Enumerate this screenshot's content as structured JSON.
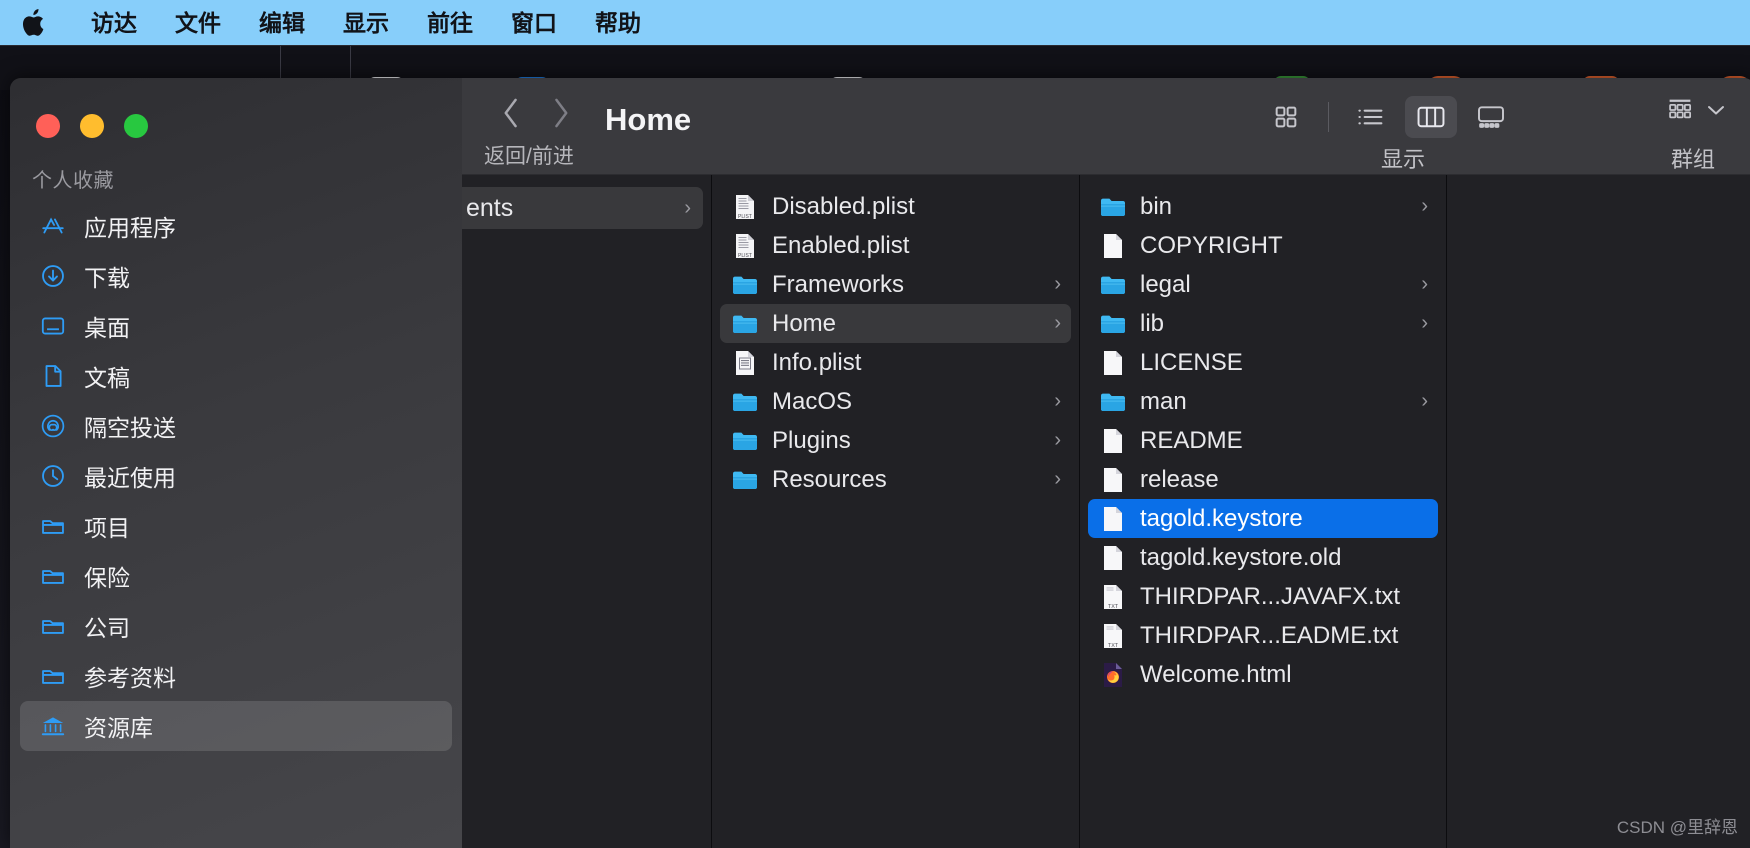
{
  "menubar": {
    "apple_icon": "apple-logo-icon",
    "background": "#87cefa",
    "items": [
      {
        "label": "访达"
      },
      {
        "label": "文件"
      },
      {
        "label": "编辑"
      },
      {
        "label": "显示"
      },
      {
        "label": "前往"
      },
      {
        "label": "窗口"
      },
      {
        "label": "帮助"
      }
    ]
  },
  "window": {
    "title": "Home",
    "traffic_lights": {
      "close": "#ff6058",
      "minimize": "#ffbd2e",
      "zoom": "#28c840"
    }
  },
  "toolbar": {
    "back_icon": "chevron-left-icon",
    "forward_icon": "chevron-right-icon",
    "nav_label": "返回/前进",
    "view_label": "显示",
    "group_label": "群组",
    "group_chevron_icon": "chevron-down-icon",
    "view_modes": [
      {
        "name": "icon-view",
        "icon": "grid-icon",
        "selected": false
      },
      {
        "name": "list-view",
        "icon": "list-icon",
        "selected": false
      },
      {
        "name": "column-view",
        "icon": "columns-icon",
        "selected": true
      },
      {
        "name": "gallery-view",
        "icon": "gallery-icon",
        "selected": false
      }
    ]
  },
  "sidebar": {
    "section_title": "个人收藏",
    "items": [
      {
        "label": "应用程序",
        "icon": "applications-icon",
        "selected": false
      },
      {
        "label": "下载",
        "icon": "downloads-icon",
        "selected": false
      },
      {
        "label": "桌面",
        "icon": "desktop-icon",
        "selected": false
      },
      {
        "label": "文稿",
        "icon": "documents-icon",
        "selected": false
      },
      {
        "label": "隔空投送",
        "icon": "airdrop-icon",
        "selected": false
      },
      {
        "label": "最近使用",
        "icon": "recents-clock-icon",
        "selected": false
      },
      {
        "label": "项目",
        "icon": "folder-icon",
        "selected": false
      },
      {
        "label": "保险",
        "icon": "folder-icon",
        "selected": false
      },
      {
        "label": "公司",
        "icon": "folder-icon",
        "selected": false
      },
      {
        "label": "参考资料",
        "icon": "folder-icon",
        "selected": false
      },
      {
        "label": "资源库",
        "icon": "library-bank-icon",
        "selected": true
      }
    ]
  },
  "columns": {
    "partial_column": {
      "items": [
        {
          "name": "ents",
          "icon": "folder-icon",
          "has_chevron": true,
          "highlighted": true
        }
      ]
    },
    "middle_column": {
      "items": [
        {
          "name": "Disabled.plist",
          "icon": "plist-file-icon",
          "has_chevron": false,
          "selected": false
        },
        {
          "name": "Enabled.plist",
          "icon": "plist-file-icon",
          "has_chevron": false,
          "selected": false
        },
        {
          "name": "Frameworks",
          "icon": "folder-icon",
          "has_chevron": true,
          "selected": false
        },
        {
          "name": "Home",
          "icon": "folder-icon",
          "has_chevron": true,
          "selected": true
        },
        {
          "name": "Info.plist",
          "icon": "plist-doc-icon",
          "has_chevron": false,
          "selected": false
        },
        {
          "name": "MacOS",
          "icon": "folder-icon",
          "has_chevron": true,
          "selected": false
        },
        {
          "name": "Plugins",
          "icon": "folder-icon",
          "has_chevron": true,
          "selected": false
        },
        {
          "name": "Resources",
          "icon": "folder-icon",
          "has_chevron": true,
          "selected": false
        }
      ]
    },
    "right_column": {
      "items": [
        {
          "name": "bin",
          "icon": "folder-icon",
          "has_chevron": true,
          "selected": false
        },
        {
          "name": "COPYRIGHT",
          "icon": "blank-file-icon",
          "has_chevron": false,
          "selected": false
        },
        {
          "name": "legal",
          "icon": "folder-icon",
          "has_chevron": true,
          "selected": false
        },
        {
          "name": "lib",
          "icon": "folder-icon",
          "has_chevron": true,
          "selected": false
        },
        {
          "name": "LICENSE",
          "icon": "blank-file-icon",
          "has_chevron": false,
          "selected": false
        },
        {
          "name": "man",
          "icon": "folder-icon",
          "has_chevron": true,
          "selected": false
        },
        {
          "name": "README",
          "icon": "blank-file-icon",
          "has_chevron": false,
          "selected": false
        },
        {
          "name": "release",
          "icon": "blank-file-icon",
          "has_chevron": false,
          "selected": false
        },
        {
          "name": "tagold.keystore",
          "icon": "blank-file-icon",
          "has_chevron": false,
          "selected": true
        },
        {
          "name": "tagold.keystore.old",
          "icon": "blank-file-icon",
          "has_chevron": false,
          "selected": false
        },
        {
          "name": "THIRDPAR...JAVAFX.txt",
          "icon": "txt-file-icon",
          "has_chevron": false,
          "selected": false
        },
        {
          "name": "THIRDPAR...EADME.txt",
          "icon": "txt-file-icon",
          "has_chevron": false,
          "selected": false
        },
        {
          "name": "Welcome.html",
          "icon": "firefox-html-icon",
          "has_chevron": false,
          "selected": false
        }
      ]
    }
  },
  "colors": {
    "selection_blue": "#0a6fe8",
    "folder_blue": "#36b5f0",
    "accent_icon_blue": "#2e9cf5",
    "menubar_blue": "#87cefa"
  },
  "watermark": "CSDN @里辞恩"
}
